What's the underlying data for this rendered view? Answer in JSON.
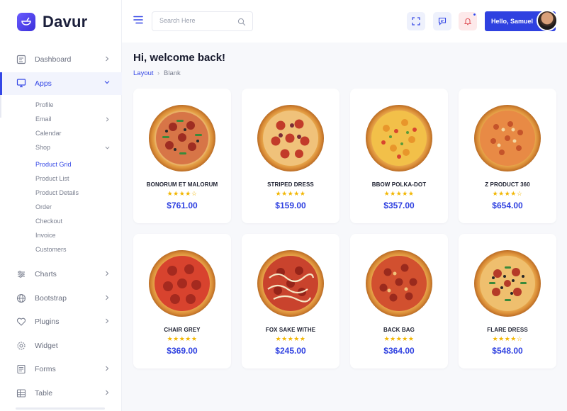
{
  "brand": {
    "name": "Davur"
  },
  "header": {
    "search_placeholder": "Search Here",
    "user_label": "Hello, Samuel"
  },
  "sidebar": {
    "items": [
      {
        "label": "Dashboard",
        "icon": "dashboard-icon"
      },
      {
        "label": "Apps",
        "icon": "monitor-icon",
        "active": true
      },
      {
        "label": "Charts",
        "icon": "sliders-icon"
      },
      {
        "label": "Bootstrap",
        "icon": "globe-icon"
      },
      {
        "label": "Plugins",
        "icon": "heart-icon"
      },
      {
        "label": "Widget",
        "icon": "settings-icon"
      },
      {
        "label": "Forms",
        "icon": "forms-icon"
      },
      {
        "label": "Table",
        "icon": "table-icon"
      }
    ],
    "apps_sub": [
      "Profile",
      "Email",
      "Calendar",
      "Shop"
    ],
    "shop_sub": [
      "Product Grid",
      "Product List",
      "Product Details",
      "Order",
      "Checkout",
      "Invoice",
      "Customers"
    ]
  },
  "main": {
    "title": "Hi, welcome back!",
    "breadcrumb": {
      "home": "Layout",
      "separator": "›",
      "current": "Blank"
    }
  },
  "products": [
    {
      "name": "BONORUM ET MALORUM",
      "rating": "★★★★☆",
      "price": "$761.00"
    },
    {
      "name": "STRIPED DRESS",
      "rating": "★★★★★",
      "price": "$159.00"
    },
    {
      "name": "BBOW POLKA-DOT",
      "rating": "★★★★★",
      "price": "$357.00"
    },
    {
      "name": "Z PRODUCT 360",
      "rating": "★★★★☆",
      "price": "$654.00"
    },
    {
      "name": "CHAIR GREY",
      "rating": "★★★★★",
      "price": "$369.00"
    },
    {
      "name": "FOX SAKE WITHE",
      "rating": "★★★★★",
      "price": "$245.00"
    },
    {
      "name": "BACK BAG",
      "rating": "★★★★★",
      "price": "$364.00"
    },
    {
      "name": "FLARE DRESS",
      "rating": "★★★★☆",
      "price": "$548.00"
    }
  ],
  "colors": {
    "accent": "#3447e6",
    "star": "#f2b705",
    "notify": "#fde9ea"
  }
}
